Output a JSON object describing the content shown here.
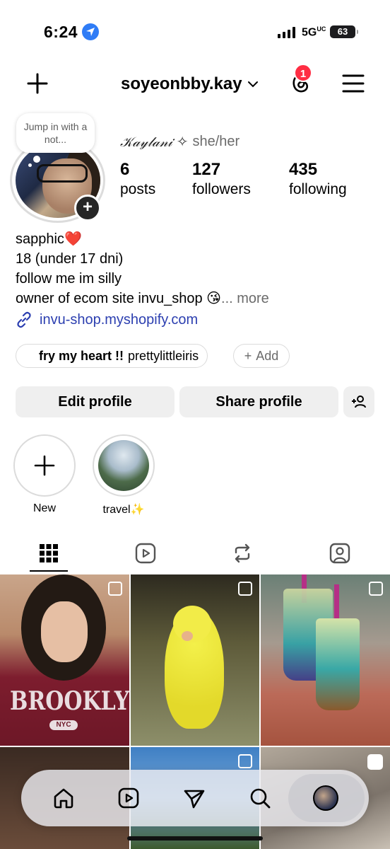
{
  "status_bar": {
    "time": "6:24",
    "network": "5G",
    "network_sup": "UC",
    "battery": "63"
  },
  "header": {
    "username": "soyeonbby.kay",
    "notification_count": "1"
  },
  "note": {
    "text": "Jump in with a not..."
  },
  "profile": {
    "display_name": "𝒦𝒶𝓎𝓁𝒶𝓃𝒾",
    "sparkle": "✧",
    "pronouns": "she/her",
    "stats": [
      {
        "num": "6",
        "label": "posts"
      },
      {
        "num": "127",
        "label": "followers"
      },
      {
        "num": "435",
        "label": "following"
      }
    ],
    "bio_lines": [
      "sapphic",
      "18 (under 17 dni)",
      "follow me im silly",
      "owner of ecom site invu_shop"
    ],
    "bio_emoji_1": "❤️",
    "bio_emoji_4": "😘",
    "more_label": "... more",
    "link": "invu-shop.myshopify.com"
  },
  "music": {
    "song": "fry my heart !!",
    "artist": "prettylittleiris",
    "add_label": "Add"
  },
  "buttons": {
    "edit": "Edit profile",
    "share": "Share profile"
  },
  "highlights": [
    {
      "label": "New"
    },
    {
      "label": "travel"
    }
  ],
  "highlight_travel_emoji": "✨",
  "colors": {
    "accent_link": "#2c3fb0",
    "badge": "#ff2d43",
    "button_bg": "#efefef"
  }
}
